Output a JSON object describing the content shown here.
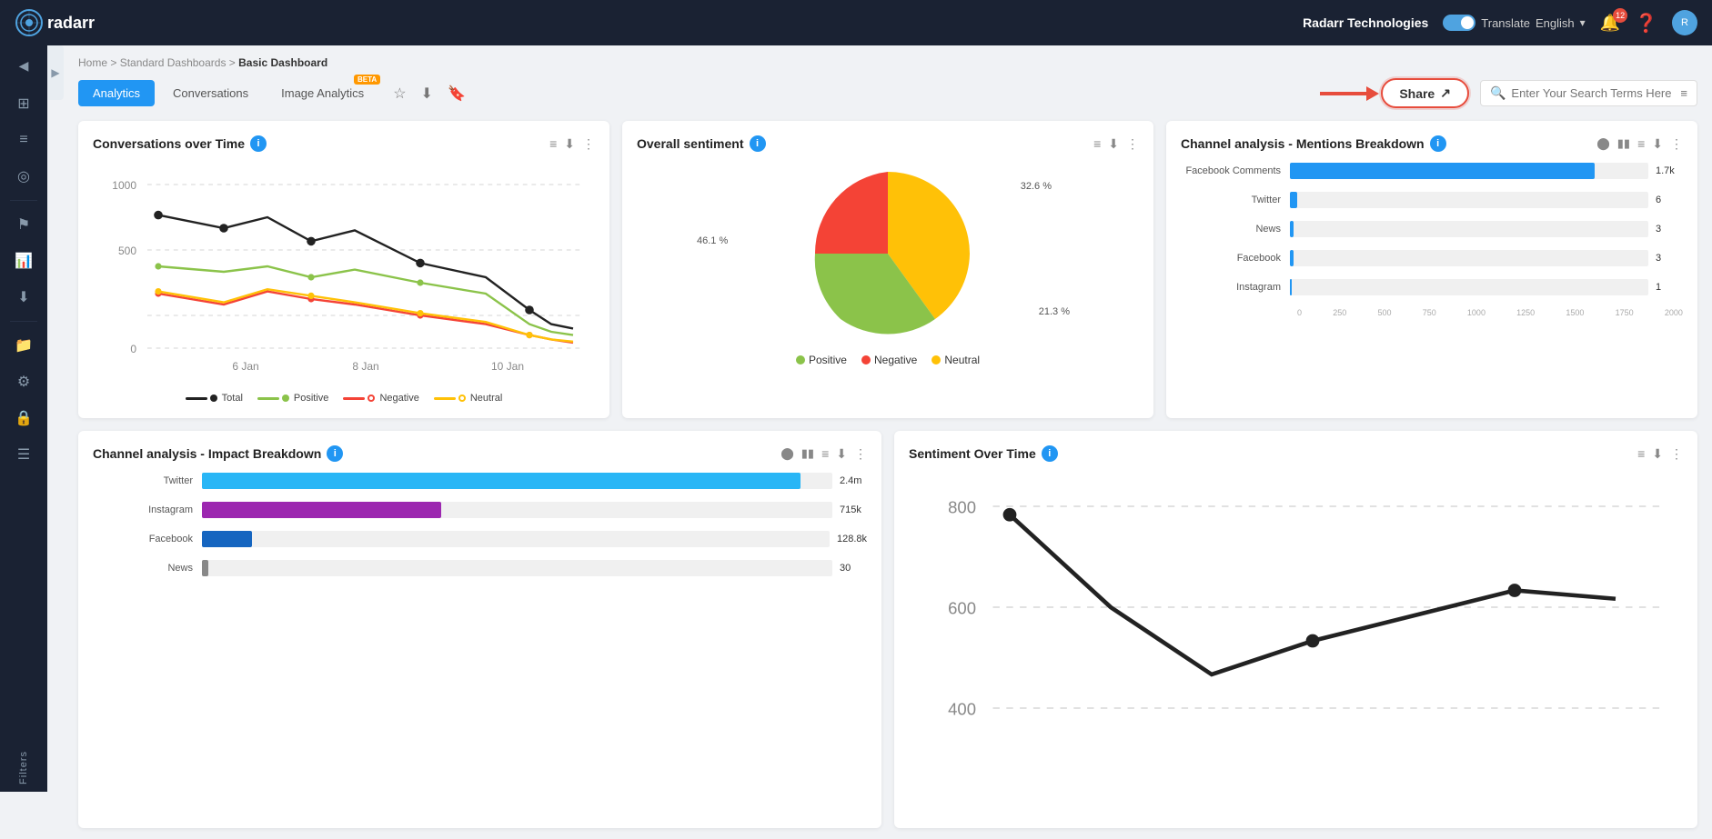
{
  "app": {
    "logo": "radarr",
    "brand": "Radarr Technologies",
    "translate_label": "Translate",
    "language": "English",
    "notification_count": "12",
    "user_initials": "R"
  },
  "breadcrumb": {
    "home": "Home",
    "separator": ">",
    "standard": "Standard Dashboards",
    "basic": "Basic Dashboard"
  },
  "tabs": {
    "analytics": "Analytics",
    "conversations": "Conversations",
    "image_analytics": "Image Analytics",
    "beta_label": "BETA"
  },
  "share_button": "Share",
  "search": {
    "placeholder": "Enter Your Search Terms Here"
  },
  "conversations_over_time": {
    "title": "Conversations over Time",
    "y_labels": [
      "1000",
      "500",
      "0"
    ],
    "x_labels": [
      "6 Jan",
      "8 Jan",
      "10 Jan"
    ],
    "legend": {
      "total": "Total",
      "positive": "Positive",
      "negative": "Negative",
      "neutral": "Neutral"
    }
  },
  "overall_sentiment": {
    "title": "Overall sentiment",
    "positive_pct": "32.6 %",
    "negative_pct": "21.3 %",
    "neutral_pct": "46.1 %",
    "positive_label": "Positive",
    "negative_label": "Negative",
    "neutral_label": "Neutral"
  },
  "channel_mentions": {
    "title": "Channel analysis - Mentions Breakdown",
    "bars": [
      {
        "label": "Facebook Comments",
        "value": "1.7k",
        "pct": 85,
        "color": "#2196f3"
      },
      {
        "label": "Twitter",
        "value": "6",
        "pct": 0.3,
        "color": "#2196f3"
      },
      {
        "label": "News",
        "value": "3",
        "pct": 0.15,
        "color": "#2196f3"
      },
      {
        "label": "Facebook",
        "value": "3",
        "pct": 0.15,
        "color": "#2196f3"
      },
      {
        "label": "Instagram",
        "value": "1",
        "pct": 0.05,
        "color": "#2196f3"
      }
    ],
    "x_labels": [
      "0",
      "250",
      "500",
      "750",
      "1000",
      "1250",
      "1500",
      "1750",
      "2000"
    ]
  },
  "channel_impact": {
    "title": "Channel analysis - Impact Breakdown",
    "bars": [
      {
        "label": "Twitter",
        "value": "2.4m",
        "pct": 95,
        "color": "#29b6f6"
      },
      {
        "label": "Instagram",
        "value": "715k",
        "pct": 38,
        "color": "#9c27b0"
      },
      {
        "label": "Facebook",
        "value": "128.8k",
        "pct": 8,
        "color": "#1565c0"
      },
      {
        "label": "News",
        "value": "30",
        "pct": 1,
        "color": "#888"
      }
    ]
  },
  "sentiment_over_time": {
    "title": "Sentiment Over Time",
    "y_labels": [
      "800",
      "600",
      "400"
    ]
  },
  "sidebar_items": [
    {
      "icon": "⊞",
      "name": "dashboard",
      "active": false
    },
    {
      "icon": "☰",
      "name": "list",
      "active": false
    },
    {
      "icon": "◎",
      "name": "targets",
      "active": false
    },
    {
      "icon": "📋",
      "name": "reports",
      "active": false
    },
    {
      "icon": "📊",
      "name": "analytics",
      "active": true
    },
    {
      "icon": "⬇",
      "name": "downloads",
      "active": false
    },
    {
      "icon": "📁",
      "name": "files",
      "active": false
    },
    {
      "icon": "⚙",
      "name": "settings",
      "active": false
    },
    {
      "icon": "🔒",
      "name": "lock",
      "active": false
    },
    {
      "icon": "☰",
      "name": "menu",
      "active": false
    }
  ],
  "colors": {
    "accent_blue": "#2196f3",
    "positive_green": "#8bc34a",
    "negative_red": "#f44336",
    "neutral_yellow": "#ffc107",
    "total_black": "#222",
    "sidebar_bg": "#1a2233",
    "card_bg": "#ffffff"
  }
}
